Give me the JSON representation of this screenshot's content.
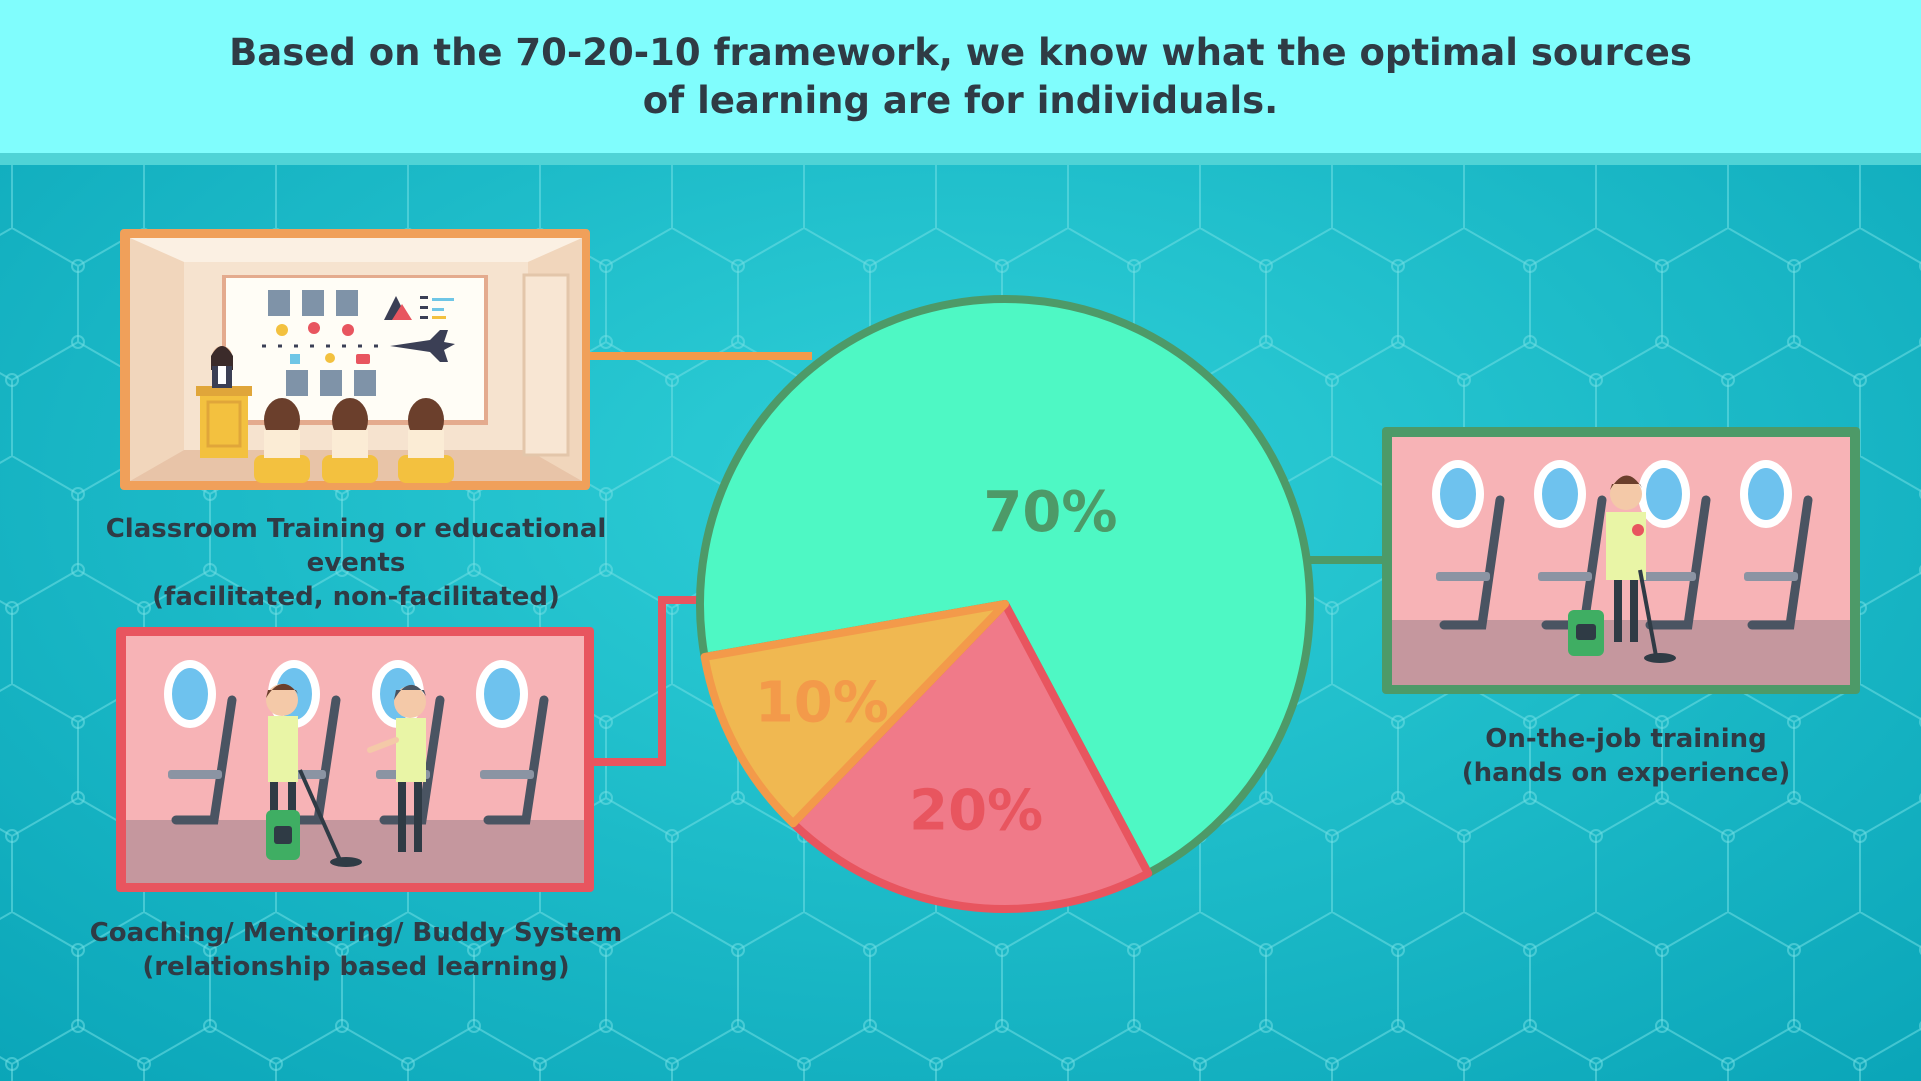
{
  "header": {
    "line1": "Based on the 70-20-10 framework, we know what the optimal sources",
    "line2": "of learning are for individuals."
  },
  "colors": {
    "background": "#1bb8c8",
    "header": "#80fdfd",
    "slice_70": "#4ef8c4",
    "slice_70_border": "#4d9a68",
    "slice_20": "#f07a89",
    "slice_20_border": "#e8555f",
    "slice_10": "#f0b851",
    "slice_10_border": "#f39a4a",
    "text_dark": "#2f3b45"
  },
  "chart_data": {
    "type": "pie",
    "slices": [
      {
        "value": 70,
        "label": "70%",
        "color": "#4ef8c4",
        "border": "#4d9a68",
        "text_color": "#4d9a68"
      },
      {
        "value": 20,
        "label": "20%",
        "color": "#f07a89",
        "border": "#e8555f",
        "text_color": "#e8555f"
      },
      {
        "value": 10,
        "label": "10%",
        "color": "#f0b851",
        "border": "#f39a4a",
        "text_color": "#f39a4a"
      }
    ],
    "annotations": [
      {
        "slice": "10%",
        "line1": "Classroom Training or educational events",
        "line2": "(facilitated, non-facilitated)"
      },
      {
        "slice": "20%",
        "line1": "Coaching/ Mentoring/ Buddy System",
        "line2": "(relationship based learning)"
      },
      {
        "slice": "70%",
        "line1": "On-the-job training",
        "line2": "(hands on experience)"
      }
    ]
  },
  "illustrations": {
    "classroom": "classroom-presentation-icon",
    "coaching": "cabin-coaching-icon",
    "onthejob": "cabin-cleaning-icon"
  }
}
